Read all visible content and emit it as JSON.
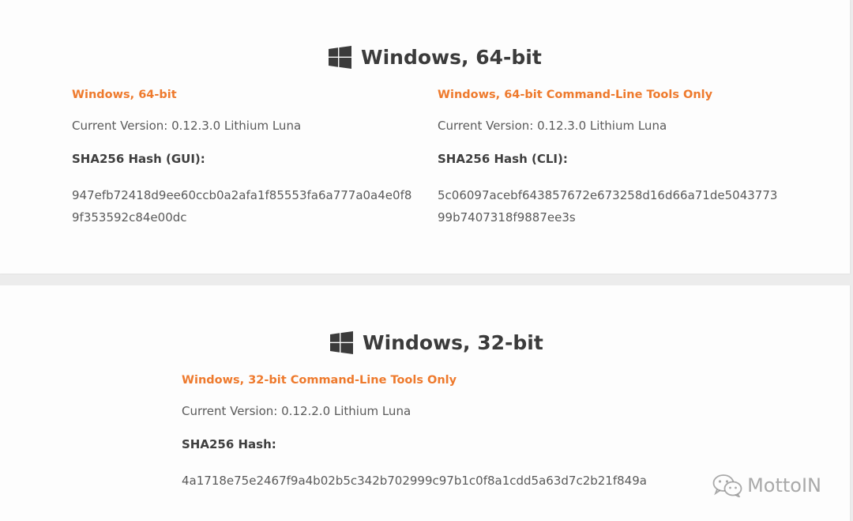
{
  "sections": [
    {
      "title": "Windows, 64-bit",
      "icon": "windows-logo-icon",
      "columns": [
        {
          "link": "Windows, 64-bit",
          "version": "Current Version: 0.12.3.0 Lithium Luna",
          "hash_label": "SHA256 Hash (GUI):",
          "hash_value": "947efb72418d9ee60ccb0a2afa1f85553fa6a777a0a4e0f89f353592c84e00dc"
        },
        {
          "link": "Windows, 64-bit Command-Line Tools Only",
          "version": "Current Version: 0.12.3.0 Lithium Luna",
          "hash_label": "SHA256 Hash (CLI):",
          "hash_value": "5c06097acebf643857672e673258d16d66a71de504377399b7407318f9887ee3s"
        }
      ]
    },
    {
      "title": "Windows, 32-bit",
      "icon": "windows-logo-icon",
      "columns": [
        {
          "link": "Windows, 32-bit Command-Line Tools Only",
          "version": "Current Version: 0.12.2.0 Lithium Luna",
          "hash_label": "SHA256 Hash:",
          "hash_value": "4a1718e75e2467f9a4b02b5c342b702999c97b1c0f8a1cdd5a63d7c2b21f849a"
        }
      ]
    }
  ],
  "watermark": {
    "text": "MottoIN",
    "icon": "wechat-icon"
  },
  "colors": {
    "link": "#ee7a2d",
    "title": "#3b3b3b",
    "body_text": "#5a5a5a",
    "card_bg": "#fdfdfd",
    "page_bg": "#ececec"
  }
}
